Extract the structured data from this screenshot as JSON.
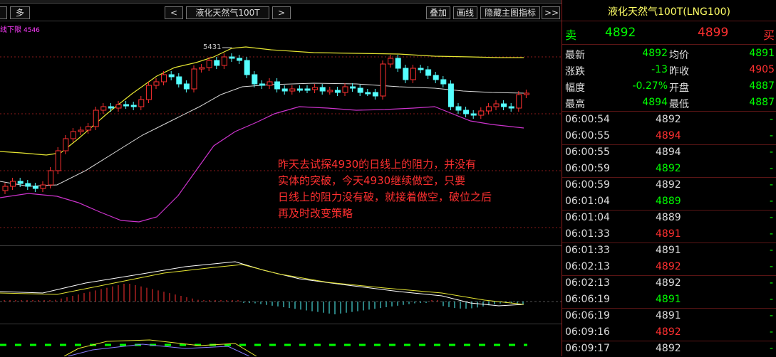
{
  "toolbar": {
    "more_label": "多",
    "prev_label": "<",
    "instrument_label": "液化天然气100T",
    "next_label": ">",
    "overlay_label": "叠加",
    "draw_label": "画线",
    "hide_indicator_label": "隐藏主图指标",
    "expand_label": ">>"
  },
  "chart": {
    "series_label": "线下限",
    "series_value": "4546",
    "peak_label": "5431",
    "annotation_lines": [
      "昨天去试探4930的日线上的阻力，并没有",
      "实体的突破，今天4930继续做空，只要",
      "日线上的阻力没有破，就接着做空，破位之后",
      "再及时改变策略"
    ]
  },
  "colors": {
    "up": "#ff3030",
    "down": "#55ffff",
    "upper_band": "#e6e632",
    "mid_band": "#dcdcdc",
    "lower_band": "#cc33cc",
    "accent_title": "#ffff66",
    "green": "#00ff00"
  },
  "panel": {
    "title": "液化天然气100T(LNG100)",
    "sell_label": "卖",
    "sell_price": "4892",
    "buy_price": "4899",
    "buy_label": "买",
    "stats": [
      {
        "label": "最新",
        "value": "4892",
        "label2": "均价",
        "value2": "4891",
        "c1": "green",
        "c2": "green"
      },
      {
        "label": "涨跌",
        "value": "-13",
        "label2": "昨收",
        "value2": "4905",
        "c1": "green",
        "c2": "red"
      },
      {
        "label": "幅度",
        "value": "-0.27%",
        "label2": "开盘",
        "value2": "4887",
        "c1": "green",
        "c2": "green"
      },
      {
        "label": "最高",
        "value": "4894",
        "label2": "最低",
        "value2": "4887",
        "c1": "green",
        "c2": "green"
      }
    ],
    "ticks": [
      {
        "time": "06:00:54",
        "price": "4892",
        "color": "white",
        "dir": "-"
      },
      {
        "time": "06:00:55",
        "price": "4894",
        "color": "red",
        "dir": "-"
      },
      {
        "time": "06:00:55",
        "price": "4894",
        "color": "white",
        "dir": "-"
      },
      {
        "time": "06:00:59",
        "price": "4892",
        "color": "green",
        "dir": "-"
      },
      {
        "time": "06:00:59",
        "price": "4892",
        "color": "white",
        "dir": "-"
      },
      {
        "time": "06:01:04",
        "price": "4889",
        "color": "green",
        "dir": "-"
      },
      {
        "time": "06:01:04",
        "price": "4889",
        "color": "white",
        "dir": "-"
      },
      {
        "time": "06:01:33",
        "price": "4891",
        "color": "red",
        "dir": "-"
      },
      {
        "time": "06:01:33",
        "price": "4891",
        "color": "white",
        "dir": "-"
      },
      {
        "time": "06:02:13",
        "price": "4892",
        "color": "red",
        "dir": "-"
      },
      {
        "time": "06:02:13",
        "price": "4892",
        "color": "white",
        "dir": "-"
      },
      {
        "time": "06:06:19",
        "price": "4891",
        "color": "green",
        "dir": "-"
      },
      {
        "time": "06:06:19",
        "price": "4891",
        "color": "white",
        "dir": "-"
      },
      {
        "time": "06:09:16",
        "price": "4892",
        "color": "red",
        "dir": "-"
      },
      {
        "time": "06:09:17",
        "price": "4892",
        "color": "white",
        "dir": "-"
      }
    ]
  }
}
